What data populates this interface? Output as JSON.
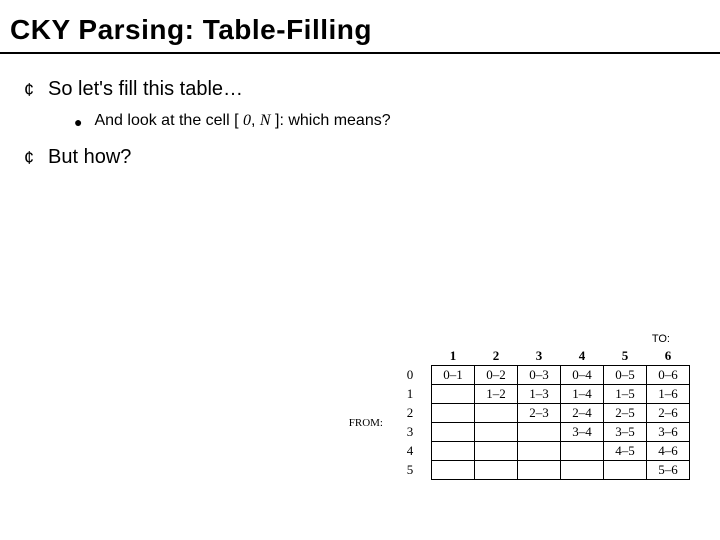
{
  "title": "CKY Parsing: Table-Filling",
  "bullets": {
    "b1": "So let's fill this table…",
    "b1_1_pre": "And look at the cell [ ",
    "b1_1_zero": "0",
    "b1_1_comma": ", ",
    "b1_1_N": "N",
    "b1_1_post": " ]: which means?",
    "b2": "But how?"
  },
  "chart_data": {
    "type": "table",
    "to_label": "TO:",
    "from_label": "FROM:",
    "col_headers": [
      "1",
      "2",
      "3",
      "4",
      "5",
      "6"
    ],
    "row_headers": [
      "0",
      "1",
      "2",
      "3",
      "4",
      "5"
    ],
    "cells": [
      [
        "0–1",
        "0–2",
        "0–3",
        "0–4",
        "0–5",
        "0–6"
      ],
      [
        "",
        "1–2",
        "1–3",
        "1–4",
        "1–5",
        "1–6"
      ],
      [
        "",
        "",
        "2–3",
        "2–4",
        "2–5",
        "2–6"
      ],
      [
        "",
        "",
        "",
        "3–4",
        "3–5",
        "3–6"
      ],
      [
        "",
        "",
        "",
        "",
        "4–5",
        "4–6"
      ],
      [
        "",
        "",
        "",
        "",
        "",
        "5–6"
      ]
    ]
  }
}
